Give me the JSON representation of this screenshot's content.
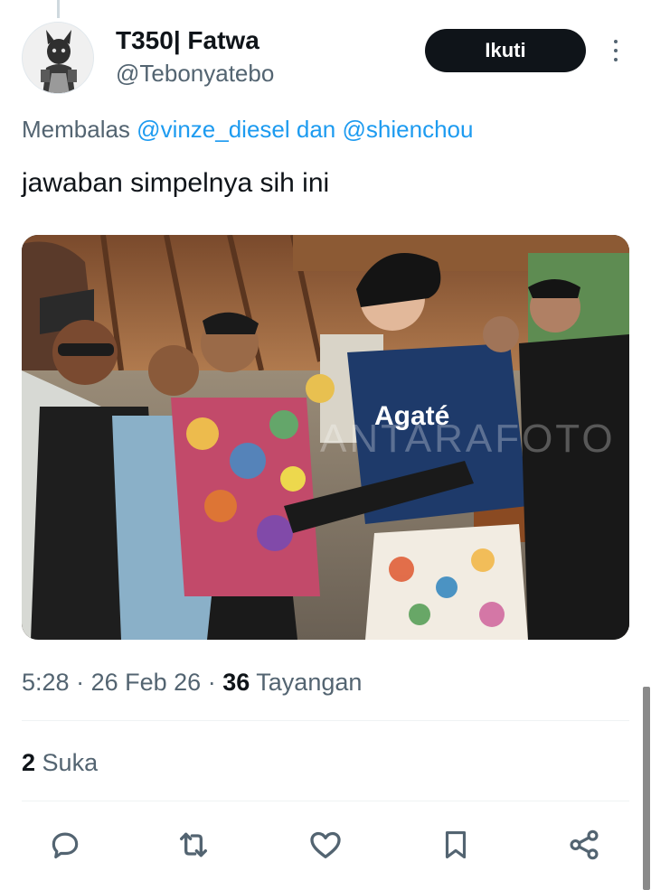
{
  "author": {
    "display_name": "T350| Fatwa",
    "handle": "@Tebonyatebo"
  },
  "follow_label": "Ikuti",
  "reply_context": {
    "prefix": "Membalas",
    "mention_1": "@vinze_diesel",
    "connector": "dan",
    "mention_2": "@shienchou"
  },
  "tweet_text": "jawaban simpelnya sih ini",
  "media": {
    "shirt_text": "Agaté",
    "watermark": "ANTARAFOTO"
  },
  "meta": {
    "time": "5:28",
    "date": "26 Feb 26",
    "views": "36",
    "views_label": "Tayangan",
    "separator": "·"
  },
  "likes": {
    "count": "2",
    "label": "Suka"
  },
  "icons": [
    "reply-icon",
    "retweet-icon",
    "like-icon",
    "bookmark-icon",
    "share-icon"
  ],
  "colors": {
    "link": "#1d9bf0",
    "secondary_text": "#536471",
    "primary_text": "#0f1419",
    "button_bg": "#0f1419"
  }
}
